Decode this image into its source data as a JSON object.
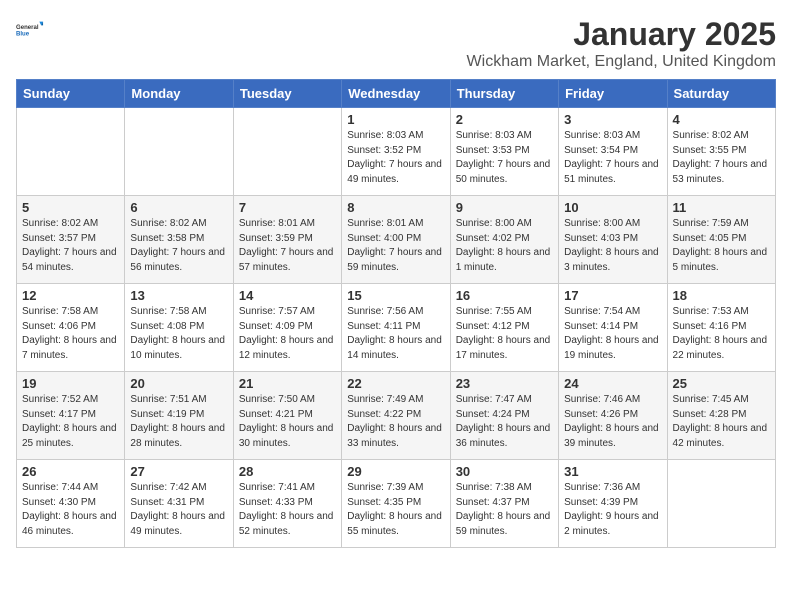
{
  "logo": {
    "general": "General",
    "blue": "Blue"
  },
  "title": "January 2025",
  "subtitle": "Wickham Market, England, United Kingdom",
  "weekdays": [
    "Sunday",
    "Monday",
    "Tuesday",
    "Wednesday",
    "Thursday",
    "Friday",
    "Saturday"
  ],
  "weeks": [
    [
      {
        "day": "",
        "info": ""
      },
      {
        "day": "",
        "info": ""
      },
      {
        "day": "",
        "info": ""
      },
      {
        "day": "1",
        "info": "Sunrise: 8:03 AM\nSunset: 3:52 PM\nDaylight: 7 hours\nand 49 minutes."
      },
      {
        "day": "2",
        "info": "Sunrise: 8:03 AM\nSunset: 3:53 PM\nDaylight: 7 hours\nand 50 minutes."
      },
      {
        "day": "3",
        "info": "Sunrise: 8:03 AM\nSunset: 3:54 PM\nDaylight: 7 hours\nand 51 minutes."
      },
      {
        "day": "4",
        "info": "Sunrise: 8:02 AM\nSunset: 3:55 PM\nDaylight: 7 hours\nand 53 minutes."
      }
    ],
    [
      {
        "day": "5",
        "info": "Sunrise: 8:02 AM\nSunset: 3:57 PM\nDaylight: 7 hours\nand 54 minutes."
      },
      {
        "day": "6",
        "info": "Sunrise: 8:02 AM\nSunset: 3:58 PM\nDaylight: 7 hours\nand 56 minutes."
      },
      {
        "day": "7",
        "info": "Sunrise: 8:01 AM\nSunset: 3:59 PM\nDaylight: 7 hours\nand 57 minutes."
      },
      {
        "day": "8",
        "info": "Sunrise: 8:01 AM\nSunset: 4:00 PM\nDaylight: 7 hours\nand 59 minutes."
      },
      {
        "day": "9",
        "info": "Sunrise: 8:00 AM\nSunset: 4:02 PM\nDaylight: 8 hours\nand 1 minute."
      },
      {
        "day": "10",
        "info": "Sunrise: 8:00 AM\nSunset: 4:03 PM\nDaylight: 8 hours\nand 3 minutes."
      },
      {
        "day": "11",
        "info": "Sunrise: 7:59 AM\nSunset: 4:05 PM\nDaylight: 8 hours\nand 5 minutes."
      }
    ],
    [
      {
        "day": "12",
        "info": "Sunrise: 7:58 AM\nSunset: 4:06 PM\nDaylight: 8 hours\nand 7 minutes."
      },
      {
        "day": "13",
        "info": "Sunrise: 7:58 AM\nSunset: 4:08 PM\nDaylight: 8 hours\nand 10 minutes."
      },
      {
        "day": "14",
        "info": "Sunrise: 7:57 AM\nSunset: 4:09 PM\nDaylight: 8 hours\nand 12 minutes."
      },
      {
        "day": "15",
        "info": "Sunrise: 7:56 AM\nSunset: 4:11 PM\nDaylight: 8 hours\nand 14 minutes."
      },
      {
        "day": "16",
        "info": "Sunrise: 7:55 AM\nSunset: 4:12 PM\nDaylight: 8 hours\nand 17 minutes."
      },
      {
        "day": "17",
        "info": "Sunrise: 7:54 AM\nSunset: 4:14 PM\nDaylight: 8 hours\nand 19 minutes."
      },
      {
        "day": "18",
        "info": "Sunrise: 7:53 AM\nSunset: 4:16 PM\nDaylight: 8 hours\nand 22 minutes."
      }
    ],
    [
      {
        "day": "19",
        "info": "Sunrise: 7:52 AM\nSunset: 4:17 PM\nDaylight: 8 hours\nand 25 minutes."
      },
      {
        "day": "20",
        "info": "Sunrise: 7:51 AM\nSunset: 4:19 PM\nDaylight: 8 hours\nand 28 minutes."
      },
      {
        "day": "21",
        "info": "Sunrise: 7:50 AM\nSunset: 4:21 PM\nDaylight: 8 hours\nand 30 minutes."
      },
      {
        "day": "22",
        "info": "Sunrise: 7:49 AM\nSunset: 4:22 PM\nDaylight: 8 hours\nand 33 minutes."
      },
      {
        "day": "23",
        "info": "Sunrise: 7:47 AM\nSunset: 4:24 PM\nDaylight: 8 hours\nand 36 minutes."
      },
      {
        "day": "24",
        "info": "Sunrise: 7:46 AM\nSunset: 4:26 PM\nDaylight: 8 hours\nand 39 minutes."
      },
      {
        "day": "25",
        "info": "Sunrise: 7:45 AM\nSunset: 4:28 PM\nDaylight: 8 hours\nand 42 minutes."
      }
    ],
    [
      {
        "day": "26",
        "info": "Sunrise: 7:44 AM\nSunset: 4:30 PM\nDaylight: 8 hours\nand 46 minutes."
      },
      {
        "day": "27",
        "info": "Sunrise: 7:42 AM\nSunset: 4:31 PM\nDaylight: 8 hours\nand 49 minutes."
      },
      {
        "day": "28",
        "info": "Sunrise: 7:41 AM\nSunset: 4:33 PM\nDaylight: 8 hours\nand 52 minutes."
      },
      {
        "day": "29",
        "info": "Sunrise: 7:39 AM\nSunset: 4:35 PM\nDaylight: 8 hours\nand 55 minutes."
      },
      {
        "day": "30",
        "info": "Sunrise: 7:38 AM\nSunset: 4:37 PM\nDaylight: 8 hours\nand 59 minutes."
      },
      {
        "day": "31",
        "info": "Sunrise: 7:36 AM\nSunset: 4:39 PM\nDaylight: 9 hours\nand 2 minutes."
      },
      {
        "day": "",
        "info": ""
      }
    ]
  ]
}
